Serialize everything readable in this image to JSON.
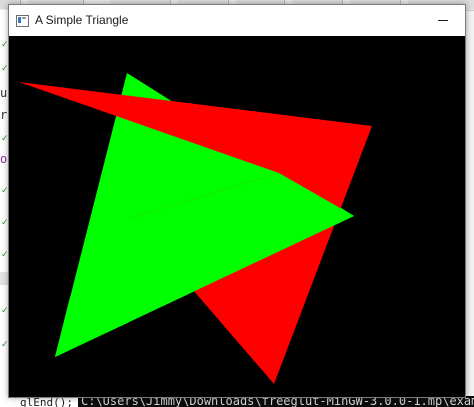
{
  "window": {
    "title": "A Simple Triangle"
  },
  "scene": {
    "background_color": "#000000",
    "triangles": [
      {
        "name": "green",
        "color": "#00ff00"
      },
      {
        "name": "red",
        "color": "#ff0000"
      }
    ]
  },
  "background": {
    "console_text": "C:\\Users\\Jimmy\\Downloads\\freeglut-MinGW-3.0.0-1.mp\\exam",
    "code_text": "glEnd();"
  }
}
